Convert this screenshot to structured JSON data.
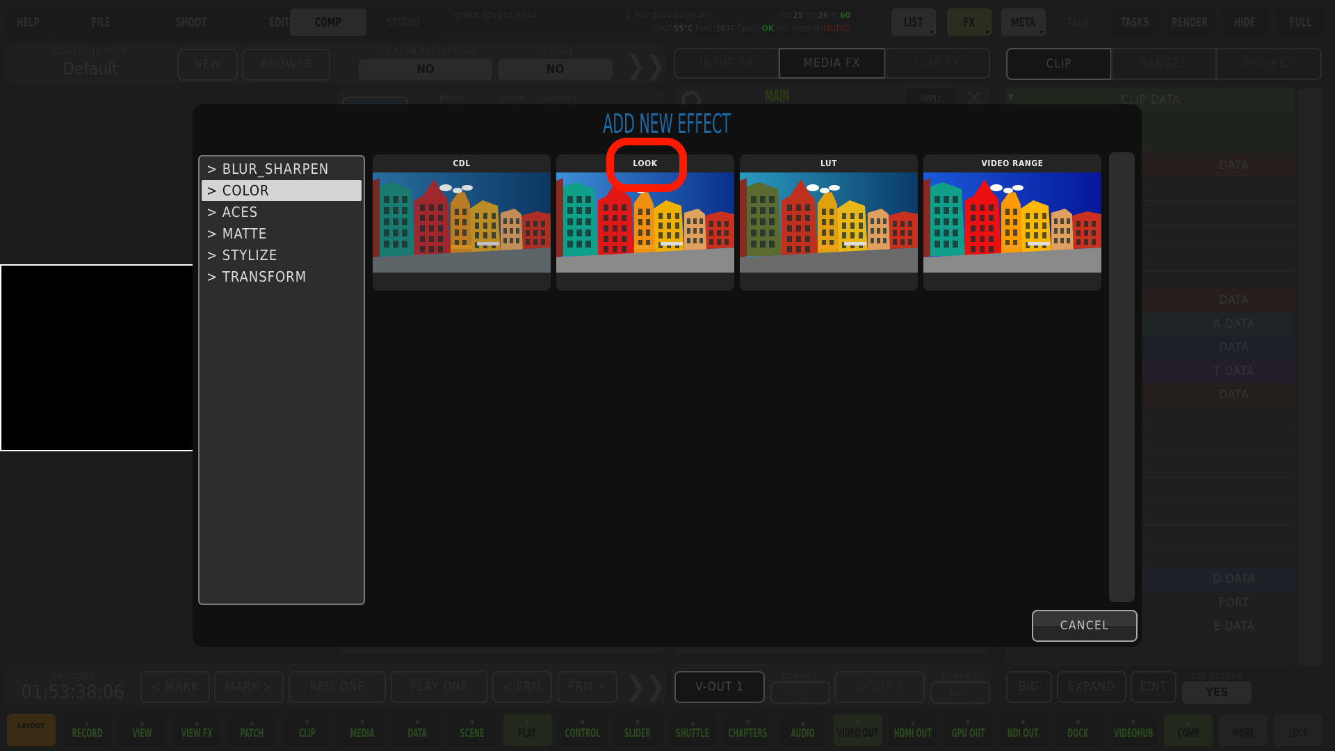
{
  "top_nav": {
    "help": "HELP",
    "tabs": [
      "FILE",
      "SHOOT",
      "EDIT",
      "COMP",
      "STUDIO"
    ],
    "selected_tab": "COMP",
    "right_buttons": [
      "LIST",
      "FX",
      "META",
      "TALK",
      "TASKS",
      "RENDER",
      "HIDE",
      "FULL"
    ]
  },
  "status": {
    "app_version": "QTAKE HDx1 v1.6.042",
    "datetime": "1. Mar 2024 14:39:46",
    "v1_label": "V1:",
    "v1_value": "25",
    "v2_label": "V2:",
    "v2_value": "26",
    "m_label": "M:",
    "m_value": "60",
    "cpu_temp_label": "CpuT:",
    "cpu_temp_value": "55°C",
    "fan_label": "Fan1:",
    "fan_value": "1697",
    "cpu_pct_label": "Cpu%:",
    "cpu_pct_value": "OK",
    "vol_label": "Vol.live/disk:",
    "vol_value": "MUTED",
    "colors": {
      "ok": "#1f5a1c",
      "muted": "#5a1a1a",
      "m": "#1f5a1c"
    }
  },
  "composite": {
    "title_label": "COMPOSITE TITLE",
    "title_value": "Default",
    "new": "NEW",
    "browse": "BROWSE",
    "osd_label": "OSD FROM FOREGROUND",
    "osd_value": "NO",
    "mode3d_label": "3D MODE",
    "mode3d_value": "NO"
  },
  "patch_tabs": [
    "PATCH",
    "UNITS",
    "CAMERAS"
  ],
  "fx_tabs": [
    "INPUT FX",
    "MEDIA FX",
    "CLIP FX"
  ],
  "fx_selected": "MEDIA FX",
  "fx_main": {
    "label": "MAIN",
    "apply": "APPLY"
  },
  "right_tabs": [
    "CLIP",
    "RANGES",
    "PROJECT"
  ],
  "right_selected": "CLIP",
  "right_panel": {
    "clip_data": "CLIP DATA",
    "sections": [
      "DATA",
      "DATA",
      "A DATA",
      "DATA",
      "T DATA",
      "DATA",
      "D DATA",
      "PORT",
      "E DATA"
    ],
    "dash": "-"
  },
  "dialog": {
    "title": "ADD NEW EFFECT",
    "categories": [
      "> BLUR_SHARPEN",
      "> COLOR",
      "> ACES",
      "> MATTE",
      "> STYLIZE",
      "> TRANSFORM"
    ],
    "selected_category": "> COLOR",
    "effects": [
      "CDL",
      "LOOK",
      "LUT",
      "VIDEO RANGE"
    ],
    "highlighted_effect": "LOOK",
    "cancel": "CANCEL",
    "title_color": "#1b6ba8",
    "highlight_color": "#ff1a00"
  },
  "transport": {
    "timecode_label": "TIMECODE",
    "timecode": "01:53:38:06",
    "buttons": [
      "< MARK",
      "MARK >",
      "REV. ONE",
      "PLAY ONE",
      "< FRM",
      "FRM >"
    ]
  },
  "outputs": {
    "vout1": "V-OUT 1",
    "demux1_label": "DEMUX 1",
    "demux1_value": "Left",
    "vout2": "V-OUT 2",
    "demux2_label": "DEMUX 2",
    "demux2_value": "Left"
  },
  "view_controls": {
    "big": "BIG",
    "expand": "EXPAND",
    "edit": "EDIT",
    "use_colors_label": "USE COLORS",
    "use_colors_value": "YES"
  },
  "bottom_bar": {
    "layout": "LAYOUT",
    "layout_value": "-",
    "buttons": [
      {
        "label": "RECORD",
        "arrow": "▲"
      },
      {
        "label": "VIEW",
        "arrow": "▲"
      },
      {
        "label": "VIEW FX",
        "arrow": "▲"
      },
      {
        "label": "PATCH",
        "arrow": "▲"
      },
      {
        "label": "CLIP",
        "arrow": "▼"
      },
      {
        "label": "MEDIA",
        "arrow": "▼"
      },
      {
        "label": "DATA",
        "arrow": "▼"
      },
      {
        "label": "SCENE",
        "arrow": "▼"
      },
      {
        "label": "PLAY",
        "arrow": "▼"
      },
      {
        "label": "CONTROL",
        "arrow": "▼"
      },
      {
        "label": "SLIDER",
        "arrow": "▼"
      },
      {
        "label": "SHUTTLE",
        "arrow": "▲"
      },
      {
        "label": "CHAPTERS",
        "arrow": "▼"
      },
      {
        "label": "AUDIO",
        "arrow": "▲"
      },
      {
        "label": "VIDEO OUT",
        "arrow": "▼"
      },
      {
        "label": "HDMI OUT",
        "arrow": "▲"
      },
      {
        "label": "GPU OUT",
        "arrow": "▼"
      },
      {
        "label": "NDI OUT",
        "arrow": "▼"
      },
      {
        "label": "DOCK",
        "arrow": "▼"
      },
      {
        "label": "VIDEOHUB",
        "arrow": "▼"
      },
      {
        "label": "COMP",
        "arrow": "▲"
      },
      {
        "label": "MORE",
        "arrow": ""
      },
      {
        "label": "LOCK",
        "arrow": ""
      }
    ],
    "active": [
      "PLAY",
      "VIDEO OUT",
      "COMP"
    ],
    "gray": [
      "MORE",
      "LOCK"
    ]
  }
}
